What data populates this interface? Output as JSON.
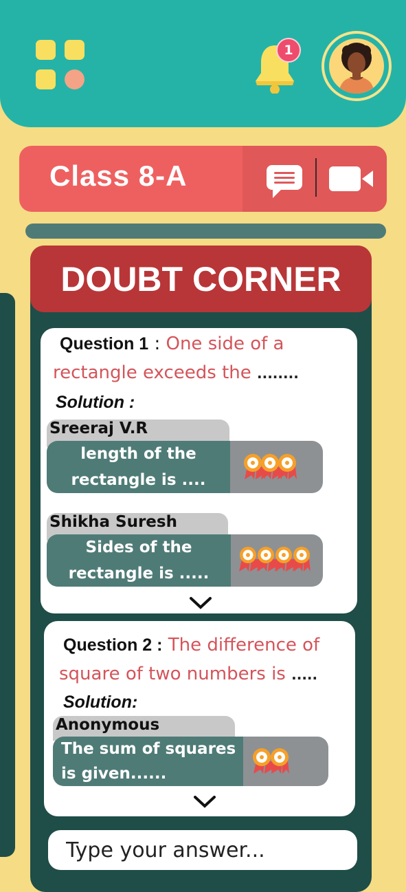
{
  "header": {
    "notification_count": "1",
    "icons": {
      "menu": "grid-menu-icon",
      "notifications": "bell-icon",
      "profile": "avatar"
    }
  },
  "class_bar": {
    "title": "Class 8-A",
    "icons": {
      "chat": "chat-icon",
      "video": "video-camera-icon"
    }
  },
  "doubt_corner": {
    "title": "DOUBT CORNER",
    "solution_label_1": "Solution :",
    "solution_label_2": "Solution:",
    "questions": [
      {
        "label": "Question 1",
        "separator": " : ",
        "text_line1": "One side of a",
        "text_line2": "rectangle exceeds the",
        "tail": "........",
        "answers": [
          {
            "name": "Sreeraj V.R",
            "line1": "length of the",
            "line2": "rectangle is ....",
            "medals": 3
          },
          {
            "name": "Shikha Suresh",
            "line1": "Sides of the",
            "line2": "rectangle is .....",
            "medals": 4
          }
        ]
      },
      {
        "label": "Question 2 :",
        "text_line1": "The difference of",
        "text_line2": "square of two numbers is",
        "tail": ".....",
        "answers": [
          {
            "name": "Anonymous",
            "line1": "The sum of squares",
            "line2": "is given......",
            "medals": 2
          }
        ]
      }
    ]
  },
  "answer_input": {
    "placeholder": "Type your answer..."
  },
  "colors": {
    "background": "#f6dc85",
    "header": "#25b3a8",
    "class_bar": "#ee6060",
    "panel": "#1f4d48",
    "panel_title": "#b83638",
    "question_text": "#d4545a",
    "answer_bubble": "#4f7b77"
  }
}
